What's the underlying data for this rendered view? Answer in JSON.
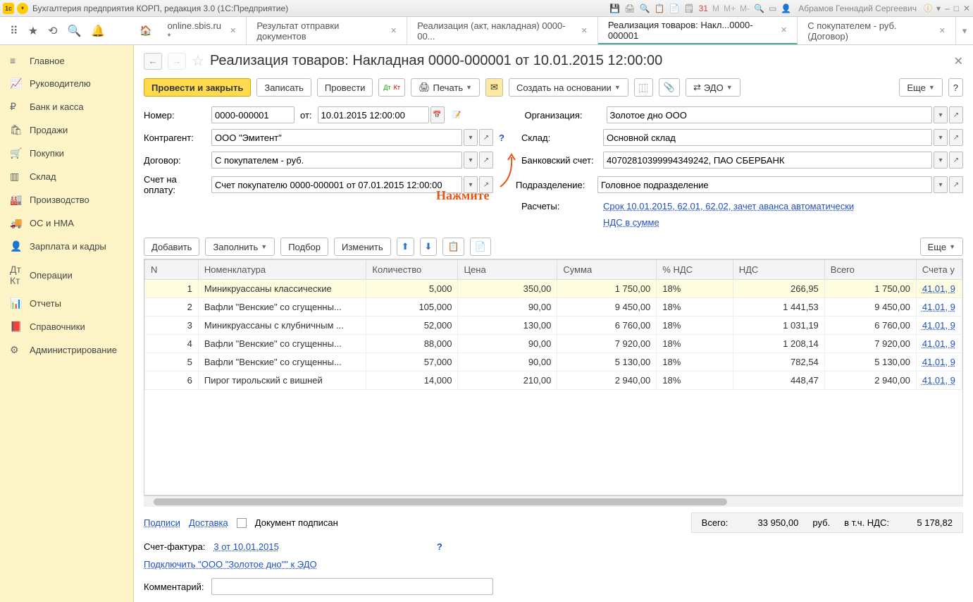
{
  "titlebar": {
    "app_title": "Бухгалтерия предприятия КОРП, редакция 3.0  (1С:Предприятие)",
    "user": "Абрамов Геннадий Сергеевич"
  },
  "tabs": [
    {
      "label": "online.sbis.ru *"
    },
    {
      "label": "Результат отправки документов"
    },
    {
      "label": "Реализация (акт, накладная) 0000-00..."
    },
    {
      "label": "Реализация товаров: Накл...0000-000001"
    },
    {
      "label": "С покупателем - руб. (Договор)"
    }
  ],
  "active_tab": 3,
  "sidebar": {
    "items": [
      {
        "label": "Главное",
        "icon": "≡"
      },
      {
        "label": "Руководителю",
        "icon": "📈"
      },
      {
        "label": "Банк и касса",
        "icon": "₽"
      },
      {
        "label": "Продажи",
        "icon": "🛍"
      },
      {
        "label": "Покупки",
        "icon": "🛒"
      },
      {
        "label": "Склад",
        "icon": "▥"
      },
      {
        "label": "Производство",
        "icon": "🏭"
      },
      {
        "label": "ОС и НМА",
        "icon": "🚚"
      },
      {
        "label": "Зарплата и кадры",
        "icon": "👤"
      },
      {
        "label": "Операции",
        "icon": "Дт Кт"
      },
      {
        "label": "Отчеты",
        "icon": "📊"
      },
      {
        "label": "Справочники",
        "icon": "📕"
      },
      {
        "label": "Администрирование",
        "icon": "⚙"
      }
    ]
  },
  "page": {
    "title": "Реализация товаров: Накладная 0000-000001 от 10.01.2015 12:00:00"
  },
  "cmd": {
    "post_close": "Провести и закрыть",
    "write": "Записать",
    "post": "Провести",
    "print": "Печать",
    "create_based": "Создать на основании",
    "edo": "ЭДО",
    "more": "Еще"
  },
  "form": {
    "number_label": "Номер:",
    "number": "0000-000001",
    "from_label": "от:",
    "date": "10.01.2015 12:00:00",
    "org_label": "Организация:",
    "org": "Золотое дно ООО",
    "contragent_label": "Контрагент:",
    "contragent": "ООО \"Эмитент\"",
    "warehouse_label": "Склад:",
    "warehouse": "Основной склад",
    "contract_label": "Договор:",
    "contract": "С покупателем - руб.",
    "bank_label": "Банковский счет:",
    "bank": "40702810399994349242, ПАО СБЕРБАНК",
    "invoice_label": "Счет на оплату:",
    "invoice": "Счет покупателю 0000-000001 от 07.01.2015 12:00:00",
    "division_label": "Подразделение:",
    "division": "Головное подразделение",
    "calc_label": "Расчеты:",
    "calc_link": "Срок 10.01.2015, 62.01, 62.02, зачет аванса автоматически",
    "vat_link": "НДС в сумме",
    "annotation": "Нажмите"
  },
  "tbar": {
    "add": "Добавить",
    "fill": "Заполнить",
    "pick": "Подбор",
    "change": "Изменить",
    "more": "Еще"
  },
  "columns": [
    "N",
    "Номенклатура",
    "Количество",
    "Цена",
    "Сумма",
    "% НДС",
    "НДС",
    "Всего",
    "Счета у"
  ],
  "rows": [
    {
      "n": "1",
      "name": "Миникруассаны классические",
      "qty": "5,000",
      "price": "350,00",
      "sum": "1 750,00",
      "vat_pct": "18%",
      "vat": "266,95",
      "total": "1 750,00",
      "acc": "41.01, 9"
    },
    {
      "n": "2",
      "name": "Вафли \"Венские\" со сгущенны...",
      "qty": "105,000",
      "price": "90,00",
      "sum": "9 450,00",
      "vat_pct": "18%",
      "vat": "1 441,53",
      "total": "9 450,00",
      "acc": "41.01, 9"
    },
    {
      "n": "3",
      "name": "Миникруассаны с клубничным ...",
      "qty": "52,000",
      "price": "130,00",
      "sum": "6 760,00",
      "vat_pct": "18%",
      "vat": "1 031,19",
      "total": "6 760,00",
      "acc": "41.01, 9"
    },
    {
      "n": "4",
      "name": "Вафли \"Венские\" со сгущенны...",
      "qty": "88,000",
      "price": "90,00",
      "sum": "7 920,00",
      "vat_pct": "18%",
      "vat": "1 208,14",
      "total": "7 920,00",
      "acc": "41.01, 9"
    },
    {
      "n": "5",
      "name": "Вафли \"Венские\" со сгущенны...",
      "qty": "57,000",
      "price": "90,00",
      "sum": "5 130,00",
      "vat_pct": "18%",
      "vat": "782,54",
      "total": "5 130,00",
      "acc": "41.01, 9"
    },
    {
      "n": "6",
      "name": "Пирог тирольский с вишней",
      "qty": "14,000",
      "price": "210,00",
      "sum": "2 940,00",
      "vat_pct": "18%",
      "vat": "448,47",
      "total": "2 940,00",
      "acc": "41.01, 9"
    }
  ],
  "footer": {
    "signatures": "Подписи",
    "delivery": "Доставка",
    "doc_signed": "Документ подписан",
    "total_label": "Всего:",
    "total": "33 950,00",
    "currency": "руб.",
    "vat_incl_label": "в т.ч. НДС:",
    "vat_incl": "5 178,82",
    "invoice_facture_label": "Счет-фактура:",
    "invoice_facture": "3 от 10.01.2015",
    "connect_edo": "Подключить \"ООО \"Золотое дно\"\" к ЭДО",
    "comment_label": "Комментарий:",
    "comment": ""
  }
}
